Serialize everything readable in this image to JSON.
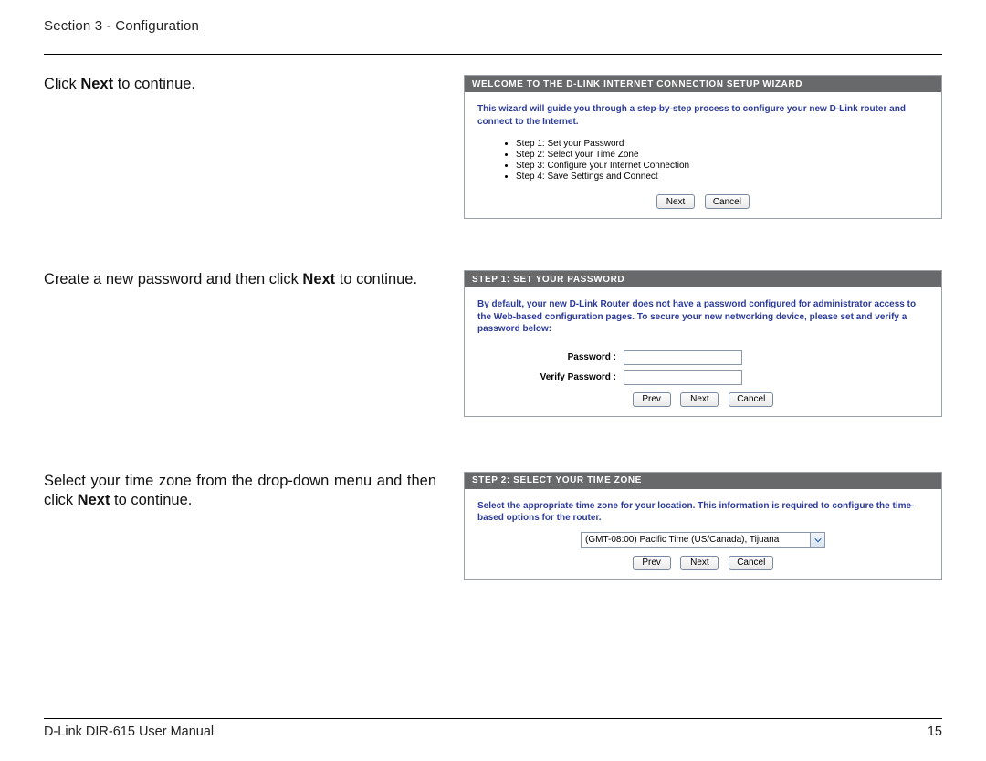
{
  "header": {
    "section": "Section 3 - Configuration"
  },
  "instructions": {
    "i1_pre": "Click ",
    "i1_bold": "Next",
    "i1_post": " to continue.",
    "i2_pre": "Create a new password and then click ",
    "i2_bold": "Next",
    "i2_post": " to continue.",
    "i3_pre": "Select your time zone from the drop-down menu and then click ",
    "i3_bold": "Next",
    "i3_post": " to continue."
  },
  "panel1": {
    "title": "WELCOME TO THE D-LINK INTERNET CONNECTION SETUP WIZARD",
    "intro": "This wizard will guide you through a step-by-step process to configure your new D-Link router and connect to the Internet.",
    "steps": [
      "Step 1: Set your Password",
      "Step 2: Select your Time Zone",
      "Step 3: Configure your Internet Connection",
      "Step 4: Save Settings and Connect"
    ],
    "next": "Next",
    "cancel": "Cancel"
  },
  "panel2": {
    "title": "STEP 1: SET YOUR PASSWORD",
    "intro": "By default, your new D-Link Router does not have a password configured for administrator access to the Web-based configuration pages. To secure your new networking device, please set and verify a password below:",
    "pw_label": "Password :",
    "vpw_label": "Verify Password :",
    "prev": "Prev",
    "next": "Next",
    "cancel": "Cancel"
  },
  "panel3": {
    "title": "STEP 2: SELECT YOUR TIME ZONE",
    "intro": "Select the appropriate time zone for your location. This information is required to configure the time-based options for the router.",
    "tz_value": "(GMT-08:00) Pacific Time (US/Canada), Tijuana",
    "prev": "Prev",
    "next": "Next",
    "cancel": "Cancel"
  },
  "footer": {
    "left": "D-Link DIR-615 User Manual",
    "right": "15"
  }
}
